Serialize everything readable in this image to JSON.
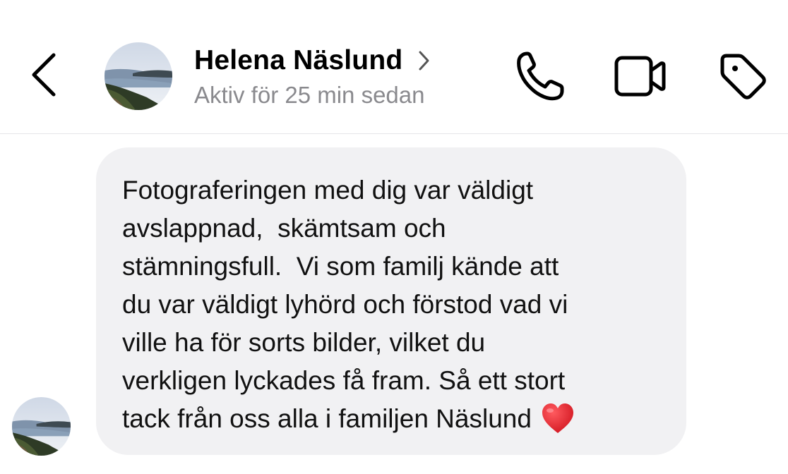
{
  "header": {
    "back_icon": "chevron-left-icon",
    "contact_name": "Helena Näslund",
    "name_chevron_icon": "chevron-right-icon",
    "status": "Aktiv för 25 min sedan",
    "actions": [
      {
        "name": "call-button",
        "icon": "phone-icon"
      },
      {
        "name": "video-call-button",
        "icon": "video-camera-icon"
      },
      {
        "name": "tag-button",
        "icon": "tag-icon"
      }
    ]
  },
  "message": {
    "lines": [
      "Fotograferingen med dig var väldigt",
      "avslappnad,  skämtsam och",
      "stämningsfull.  Vi som familj kände att",
      "du var väldigt lyhörd och förstod vad vi",
      "ville ha för sorts bilder, vilket du",
      "verkligen lyckades få fram. Så ett stort",
      "tack från oss alla i familjen Näslund"
    ],
    "emoji": "heart-emoji-icon"
  },
  "colors": {
    "bubble_bg": "#f1f1f3",
    "status_text": "#8a8a8e",
    "divider": "#e6e6e8",
    "heart": "#e0202d"
  }
}
